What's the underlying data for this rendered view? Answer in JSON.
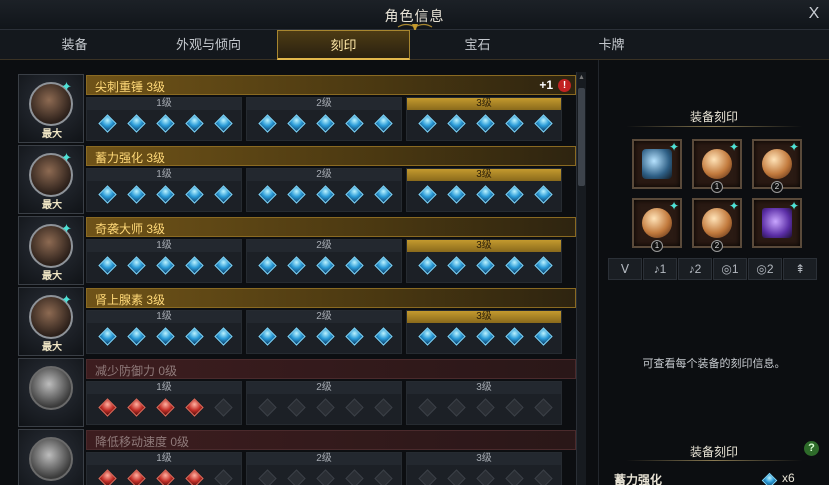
{
  "window": {
    "title": "角色信息",
    "close": "X"
  },
  "tabs": [
    "装备",
    "外观与倾向",
    "刻印",
    "宝石",
    "卡牌"
  ],
  "active_tab": 2,
  "engravings": [
    {
      "name": "尖刺重锤 3级",
      "badge": "最大",
      "bonus": "+1",
      "alert": "!",
      "active": true,
      "levels": [
        "1级",
        "2级",
        "3级"
      ],
      "filled_level": 3,
      "gem_color": "blue"
    },
    {
      "name": "蓄力强化 3级",
      "badge": "最大",
      "active": true,
      "levels": [
        "1级",
        "2级",
        "3级"
      ],
      "filled_level": 3,
      "gem_color": "blue"
    },
    {
      "name": "奇袭大师 3级",
      "badge": "最大",
      "active": true,
      "levels": [
        "1级",
        "2级",
        "3级"
      ],
      "filled_level": 3,
      "gem_color": "blue"
    },
    {
      "name": "肾上腺素 3级",
      "badge": "最大",
      "active": true,
      "levels": [
        "1级",
        "2级",
        "3级"
      ],
      "filled_level": 3,
      "gem_color": "blue"
    },
    {
      "name": "减少防御力 0级",
      "active": false,
      "levels": [
        "1级",
        "2级",
        "3级"
      ],
      "filled_level": 0,
      "gem_color": "red",
      "red_count": 4
    },
    {
      "name": "降低移动速度 0级",
      "active": false,
      "levels": [
        "1级",
        "2级",
        "3级"
      ],
      "filled_level": 0,
      "gem_color": "red",
      "red_count": 4
    }
  ],
  "right_panel": {
    "title": "装备刻印",
    "slots": [
      {
        "type": "neck",
        "num": ""
      },
      {
        "type": "earring",
        "num": "1"
      },
      {
        "type": "earring",
        "num": "2"
      },
      {
        "type": "ring",
        "num": "1"
      },
      {
        "type": "ring",
        "num": "2"
      },
      {
        "type": "stone",
        "num": ""
      }
    ],
    "filter_icons": [
      "ᐯ",
      "♪1",
      "♪2",
      "◎1",
      "◎2",
      "⇞"
    ],
    "info": "可查看每个装备的刻印信息。",
    "title2": "装备刻印",
    "help": "?",
    "summary": {
      "name": "蓄力强化",
      "count": "x6"
    }
  },
  "colors": {
    "accent_gold": "#e3b84d",
    "gem_blue": "#2a9bd8",
    "gem_red": "#c42f28",
    "plus_cyan": "#4ee1d6"
  }
}
